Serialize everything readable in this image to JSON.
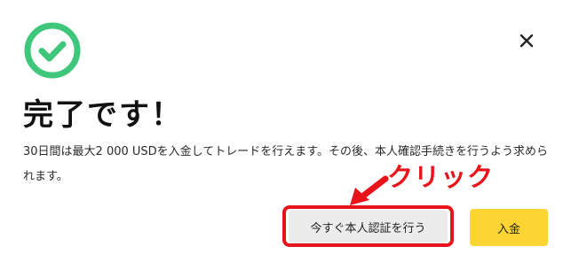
{
  "dialog": {
    "title": "完了です！",
    "message": "30日間は最大2 000 USDを入金してトレードを行えます。その後、本人確認手続きを行うよう求められます。",
    "close_icon": "close-icon",
    "status_icon": "check-circle-icon",
    "buttons": {
      "verify_now_label": "今すぐ本人認証を行う",
      "deposit_label": "入金"
    }
  },
  "annotation": {
    "label": "クリック",
    "arrow_icon": "arrow-icon"
  },
  "colors": {
    "success": "#3ec77a",
    "accent_button": "#fcd535",
    "secondary_button": "#ececec",
    "annotation": "#e8141b"
  }
}
